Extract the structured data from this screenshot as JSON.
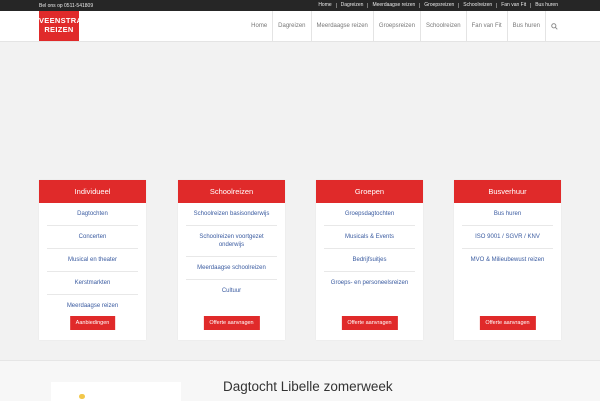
{
  "topbar": {
    "phone": "Bel ons op 0511-541809",
    "links": [
      "Home",
      "Dagreizen",
      "Meerdaagse reizen",
      "Groepsreizen",
      "Schoolreizen",
      "Fan van Fit",
      "Bus huren"
    ]
  },
  "logo": {
    "line1": "VEENSTRA",
    "line2": "REIZEN"
  },
  "nav": {
    "items": [
      "Home",
      "Dagreizen",
      "Meerdaagse reizen",
      "Groepsreizen",
      "Schoolreizen",
      "Fan van Fit",
      "Bus huren"
    ],
    "search_icon": "search-icon"
  },
  "cards": [
    {
      "title": "Individueel",
      "links": [
        "Dagtochten",
        "Concerten",
        "Musical en theater",
        "Kerstmarkten",
        "Meerdaagse reizen"
      ],
      "button": "Aanbiedingen"
    },
    {
      "title": "Schoolreizen",
      "links": [
        "Schoolreizen basisonderwijs",
        "Schoolreizen voortgezet onderwijs",
        "Meerdaagse schoolreizen",
        "Cultuur"
      ],
      "button": "Offerte aanvragen"
    },
    {
      "title": "Groepen",
      "links": [
        "Groepsdagtochten",
        "Musicals & Events",
        "Bedrijfsuitjes",
        "Groeps- en personeelsreizen"
      ],
      "button": "Offerte aanvragen"
    },
    {
      "title": "Busverhuur",
      "links": [
        "Bus huren",
        "ISO 9001 / SGVR / KNV",
        "MVO & Milieubewust reizen"
      ],
      "button": "Offerte aanvragen"
    }
  ],
  "featured": {
    "title": "Dagtocht Libelle zomerweek"
  },
  "colors": {
    "brand_red": "#e02a2a",
    "link_blue": "#3a5ba0",
    "topbar_bg": "#262626"
  }
}
